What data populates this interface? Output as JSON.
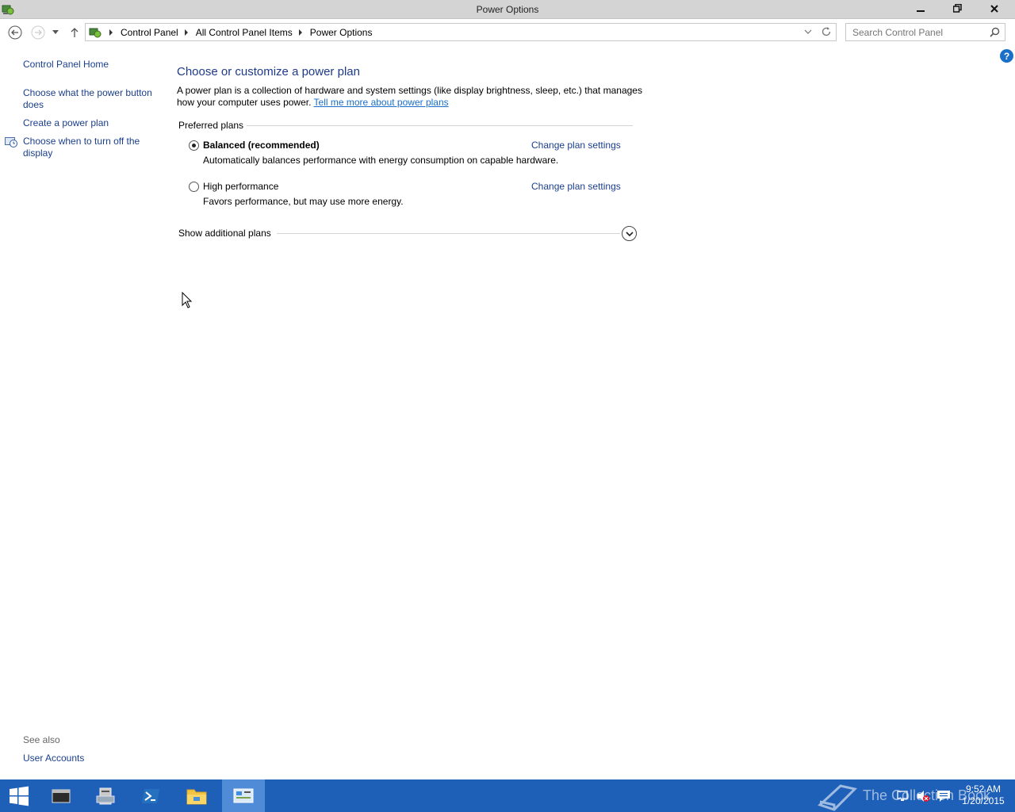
{
  "window": {
    "title": "Power Options",
    "minimize_icon": "minimize-icon",
    "maximize_icon": "restore-icon",
    "close_icon": "close-icon"
  },
  "address": {
    "crumbs": [
      "Control Panel",
      "All Control Panel Items",
      "Power Options"
    ]
  },
  "search": {
    "placeholder": "Search Control Panel"
  },
  "sidebar": {
    "home": "Control Panel Home",
    "links": [
      "Choose what the power button does",
      "Create a power plan",
      "Choose when to turn off the display"
    ],
    "see_also_title": "See also",
    "see_also_links": [
      "User Accounts"
    ]
  },
  "main": {
    "title": "Choose or customize a power plan",
    "description": "A power plan is a collection of hardware and system settings (like display brightness, sleep, etc.) that manages how your computer uses power.",
    "learn_more": "Tell me more about power plans",
    "preferred_plans": "Preferred plans",
    "plans": [
      {
        "name": "Balanced (recommended)",
        "description": "Automatically balances performance with energy consumption on capable hardware.",
        "selected": true,
        "link": "Change plan settings"
      },
      {
        "name": "High performance",
        "description": "Favors performance, but may use more energy.",
        "selected": false,
        "link": "Change plan settings"
      }
    ],
    "show_additional": "Show additional plans"
  },
  "taskbar": {
    "watermark": "The Collection Book",
    "time": "9:52 AM",
    "date": "1/20/2015"
  },
  "colors": {
    "link": "#1a3f8c",
    "heading": "#1e3a8a",
    "taskbar": "#1e5fb8"
  }
}
